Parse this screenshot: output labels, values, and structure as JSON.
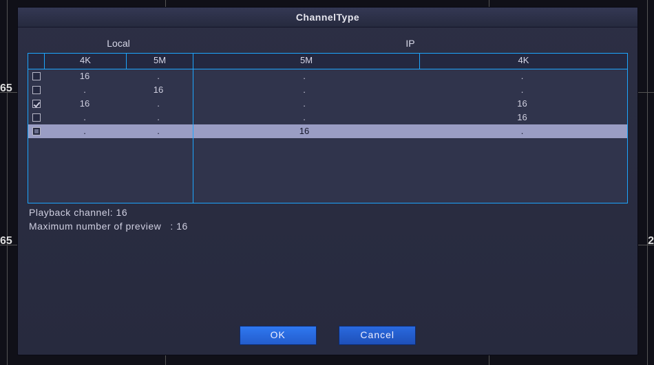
{
  "title": "ChannelType",
  "groups": {
    "local": "Local",
    "ip": "IP"
  },
  "columns": {
    "local_4k": "4K",
    "local_5m": "5M",
    "ip_5m": "5M",
    "ip_4k": "4K"
  },
  "rows": [
    {
      "checked": false,
      "filled": false,
      "local_4k": "16",
      "local_5m": ".",
      "ip_5m": ".",
      "ip_4k": "."
    },
    {
      "checked": false,
      "filled": false,
      "local_4k": ".",
      "local_5m": "16",
      "ip_5m": ".",
      "ip_4k": "."
    },
    {
      "checked": true,
      "filled": false,
      "local_4k": "16",
      "local_5m": ".",
      "ip_5m": ".",
      "ip_4k": "16"
    },
    {
      "checked": false,
      "filled": false,
      "local_4k": ".",
      "local_5m": ".",
      "ip_5m": ".",
      "ip_4k": "16"
    },
    {
      "checked": false,
      "filled": true,
      "local_4k": ".",
      "local_5m": ".",
      "ip_5m": "16",
      "ip_4k": ".",
      "selected": true
    }
  ],
  "info": {
    "playback_label": "Playback channel:",
    "playback_value": "16",
    "preview_label": "Maximum number of preview",
    "preview_sep": ":",
    "preview_value": "16"
  },
  "buttons": {
    "ok": "OK",
    "cancel": "Cancel"
  }
}
